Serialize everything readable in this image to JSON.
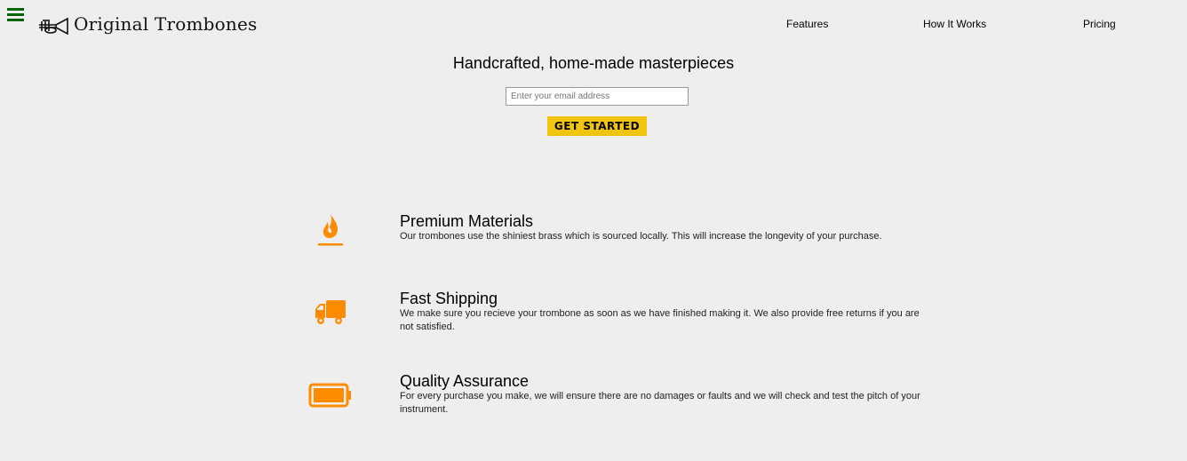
{
  "header": {
    "brand": "Original Trombones",
    "nav": [
      "Features",
      "How It Works",
      "Pricing"
    ]
  },
  "hero": {
    "title": "Handcrafted, home-made masterpieces",
    "email_placeholder": "Enter your email address",
    "cta_label": "GET STARTED"
  },
  "features": [
    {
      "icon": "flame-icon",
      "title": "Premium Materials",
      "desc": "Our trombones use the shiniest brass which is sourced locally. This will increase the longevity of your purchase."
    },
    {
      "icon": "truck-icon",
      "title": "Fast Shipping",
      "desc": "We make sure you recieve your trombone as soon as we have finished making it. We also provide free returns if you are not satisfied."
    },
    {
      "icon": "battery-icon",
      "title": "Quality Assurance",
      "desc": "For every purchase you make, we will ensure there are no damages or faults and we will check and test the pitch of your instrument."
    }
  ],
  "colors": {
    "accent": "#ff8c00",
    "cta": "#f1c40f",
    "menu": "#006400",
    "background": "#eeeeee"
  }
}
